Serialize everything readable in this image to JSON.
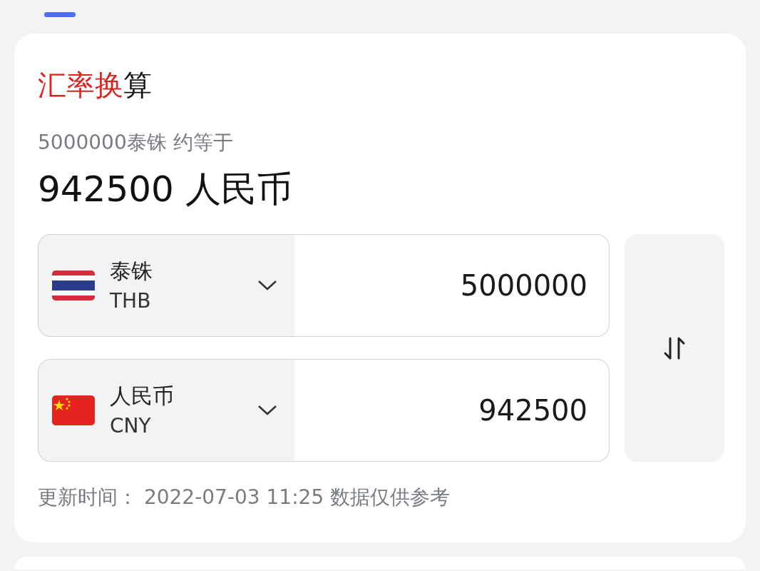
{
  "title": [
    {
      "text": "汇率换",
      "highlighted": true
    },
    {
      "text": "算",
      "highlighted": false
    }
  ],
  "summary": {
    "caption": "5000000泰铢 约等于",
    "result": "942500 人民币"
  },
  "currencies": [
    {
      "name": "泰铢",
      "code": "THB",
      "kind": "thailand",
      "amount": "5000000"
    },
    {
      "name": "人民币",
      "code": "CNY",
      "kind": "china",
      "amount": "942500"
    }
  ],
  "footer": "更新时间： 2022-07-03 11:25 数据仅供参考"
}
